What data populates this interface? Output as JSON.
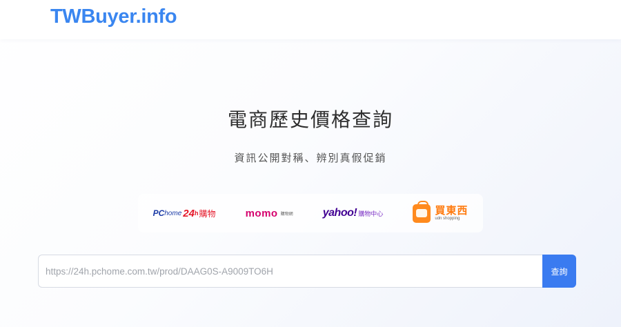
{
  "navbar": {
    "brand": "TWBuyer.info"
  },
  "hero": {
    "title": "電商歷史價格查詢",
    "subtitle": "資訊公開對稱、辨別真假促銷"
  },
  "logos": {
    "pchome": {
      "p": "PC",
      "home": "home",
      "n24": "24",
      "hr": "h",
      "shop": "購物"
    },
    "momo": {
      "word": "momo",
      "sub": "購物網"
    },
    "yahoo": {
      "word": "yahoo!",
      "sub": "購物中心"
    },
    "udn": {
      "main": "買東西",
      "sub": "udn shopping",
      "icon": "shopping-bag-icon"
    }
  },
  "search": {
    "placeholder": "https://24h.pchome.com.tw/prod/DAAG0S-A9009TO6H",
    "value": "",
    "button_label": "查詢"
  },
  "colors": {
    "brand": "#3a86f0",
    "button": "#3a7bf0",
    "pchome_blue": "#1a3aa6",
    "pchome_red": "#e5182a",
    "momo": "#d5006d",
    "yahoo": "#410093",
    "udn": "#ff8a1e"
  }
}
